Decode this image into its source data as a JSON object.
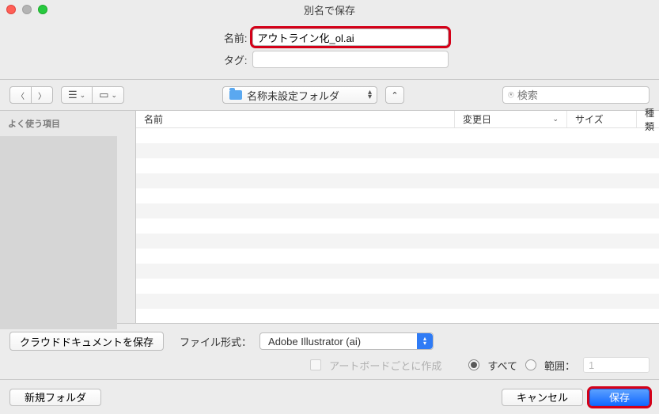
{
  "window": {
    "title": "別名で保存"
  },
  "name_section": {
    "name_label": "名前:",
    "tag_label": "タグ:",
    "filename": "アウトライン化_ol.ai",
    "tags": ""
  },
  "toolbar": {
    "location": "名称未設定フォルダ",
    "search_placeholder": "検索"
  },
  "sidebar": {
    "favorites_heading": "よく使う項目"
  },
  "columns": {
    "name": "名前",
    "date": "変更日",
    "size": "サイズ",
    "type": "種類"
  },
  "format": {
    "cloud_button": "クラウドドキュメントを保存",
    "label": "ファイル形式：",
    "value": "Adobe Illustrator (ai)"
  },
  "artboard": {
    "per_artboard": "アートボードごとに作成",
    "all": "すべて",
    "range": "範囲：",
    "range_value": "1"
  },
  "footer": {
    "new_folder": "新規フォルダ",
    "cancel": "キャンセル",
    "save": "保存"
  }
}
